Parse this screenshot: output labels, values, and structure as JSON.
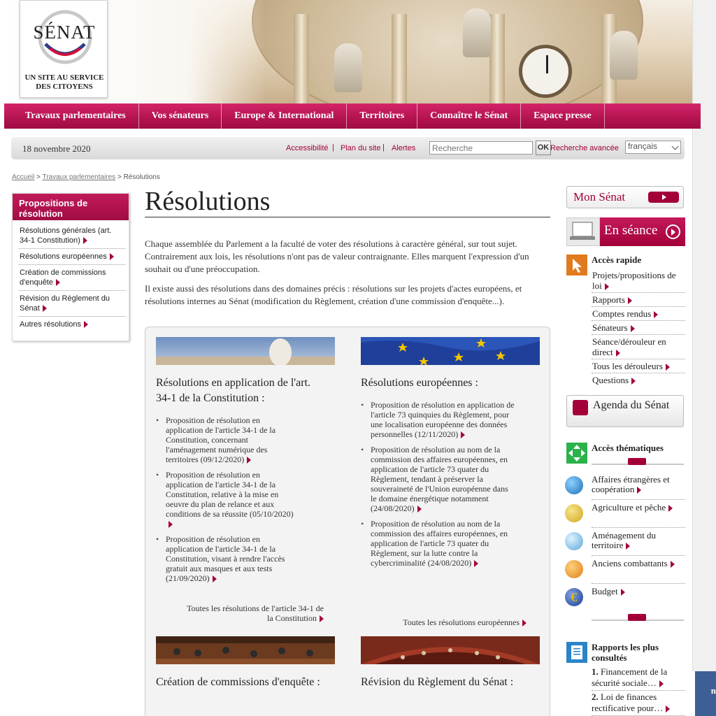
{
  "brand": {
    "logo_text": "SÉNAT",
    "tagline": "UN SITE AU SERVICE DES CITOYENS"
  },
  "nav": {
    "items": [
      {
        "label": "Travaux parlementaires"
      },
      {
        "label": "Vos sénateurs"
      },
      {
        "label": "Europe & International"
      },
      {
        "label": "Territoires"
      },
      {
        "label": "Connaître le Sénat"
      },
      {
        "label": "Espace presse"
      }
    ]
  },
  "utility": {
    "date": "18 novembre 2020",
    "links": {
      "accessibility": "Accessibilité",
      "sitemap": "Plan du site",
      "alerts": "Alertes"
    },
    "search_placeholder": "Recherche",
    "ok_label": "OK",
    "advanced_search": "Recherche avancée",
    "language": "français"
  },
  "breadcrumb": {
    "home": "Accueil",
    "section": "Travaux parlementaires",
    "current": "Résolutions"
  },
  "left_menu": {
    "title": "Propositions de résolution",
    "items": [
      {
        "label": "Résolutions générales (art. 34-1 Constitution)"
      },
      {
        "label": "Résolutions européennes"
      },
      {
        "label": "Création de commissions d'enquête"
      },
      {
        "label": "Révision du Règlement du Sénat"
      },
      {
        "label": "Autres résolutions"
      }
    ]
  },
  "main": {
    "title": "Résolutions",
    "intro_1": "Chaque assemblée du Parlement a la faculté de voter des résolutions à caractère général, sur tout sujet. Contrairement aux lois, les résolutions n'ont pas de valeur contraignante. Elles marquent l'expression d'un souhait ou d'une préoccupation.",
    "intro_2": "Il existe aussi des résolutions dans des domaines précis : résolutions sur les projets d'actes européens, et résolutions internes au Sénat (modification du Règlement, création d'une commission d'enquête...).",
    "cards": {
      "constitution": {
        "title": "Résolutions en application de l'art. 34-1 de la Constitution :",
        "items": [
          "Proposition de résolution en application de l'article 34-1 de la Constitution, concernant l'aménagement numérique des territoires (09/12/2020)",
          "Proposition de résolution en application de l'article 34-1 de la Constitution, relative à la mise en oeuvre du plan de relance et aux conditions de sa réussite (05/10/2020)",
          "Proposition de résolution en application de l'article 34-1 de la Constitution, visant à rendre l'accès gratuit aux masques et aux tests (21/09/2020)"
        ],
        "see_all": "Toutes les résolutions de l'article 34-1 de la Constitution"
      },
      "europe": {
        "title": "Résolutions européennes :",
        "items": [
          "Proposition de résolution en application de l'article 73 quinquies du Règlement, pour une localisation européenne des données personnelles (12/11/2020)",
          "Proposition de résolution au nom de la commission des affaires européennes, en application de l'article 73 quater du Règlement, tendant à préserver la souveraineté de l'Union européenne dans le domaine énergétique notamment (24/08/2020)",
          "Proposition de résolution au nom de la commission des affaires européennes, en application de l'article 73 quater du Règlement, sur la lutte contre la cybercriminalité (24/08/2020)"
        ],
        "see_all": "Toutes les résolutions européennes"
      },
      "inquiry": {
        "title": "Création de commissions d'enquête :"
      },
      "rules": {
        "title": "Révision du Règlement du Sénat :"
      }
    }
  },
  "right": {
    "mon_senat": "Mon Sénat",
    "en_seance": "En séance",
    "quick_access": {
      "title": "Accès rapide",
      "items": [
        "Projets/propositions de loi",
        "Rapports",
        "Comptes rendus",
        "Sénateurs",
        "Séance/dérouleur en direct",
        "Tous les dérouleurs",
        "Questions"
      ]
    },
    "agenda": "Agenda du Sénat",
    "themes": {
      "title": "Accès thématiques",
      "items": [
        {
          "label": "Affaires étrangères et coopération",
          "icon": "globe-icon"
        },
        {
          "label": "Agriculture et pêche",
          "icon": "wheat-icon"
        },
        {
          "label": "Aménagement du territoire",
          "icon": "compass-icon"
        },
        {
          "label": "Anciens combattants",
          "icon": "medal-icon"
        },
        {
          "label": "Budget",
          "icon": "euro-icon"
        }
      ]
    },
    "reports": {
      "title": "Rapports les plus consultés",
      "items": [
        {
          "num": "1.",
          "label": "Financement de la sécurité sociale…"
        },
        {
          "num": "2.",
          "label": "Loi de finances rectificative pour…"
        }
      ]
    }
  },
  "side_tab": "n",
  "colors": {
    "brand": "#a3003a",
    "nav": "#b3134f",
    "panel": "#f3f3f3"
  }
}
